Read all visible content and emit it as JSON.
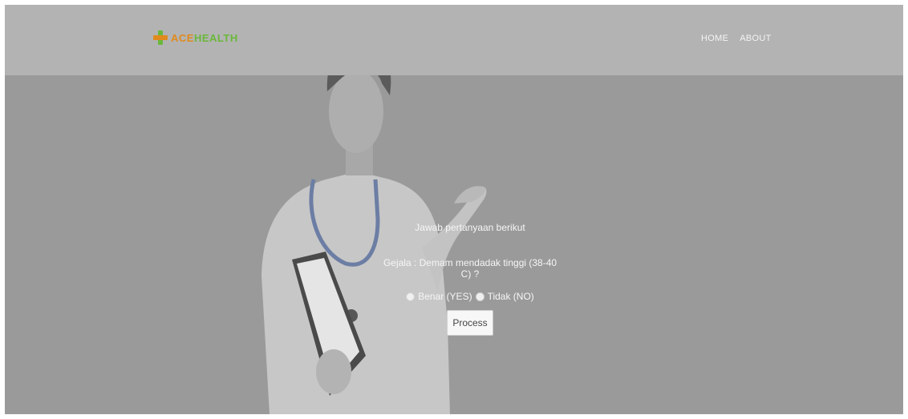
{
  "brand": {
    "logo_prefix": "ACE",
    "logo_suffix": "HEALTH",
    "colors": {
      "accent_orange": "#e08a1e",
      "accent_green": "#6ab83b"
    }
  },
  "nav": {
    "items": [
      {
        "label": "HOME"
      },
      {
        "label": "ABOUT"
      }
    ]
  },
  "form": {
    "intro": "Jawab pertanyaan berikut",
    "question": "Gejala : Demam mendadak tinggi (38-40 C) ?",
    "options": [
      {
        "label": "Benar (YES)"
      },
      {
        "label": "Tidak (NO)"
      }
    ],
    "submit_label": "Process"
  },
  "colors": {
    "page_overlay": "#9a9a9a",
    "navbar": "#b3b3b3",
    "text": "#f6f6f6"
  }
}
